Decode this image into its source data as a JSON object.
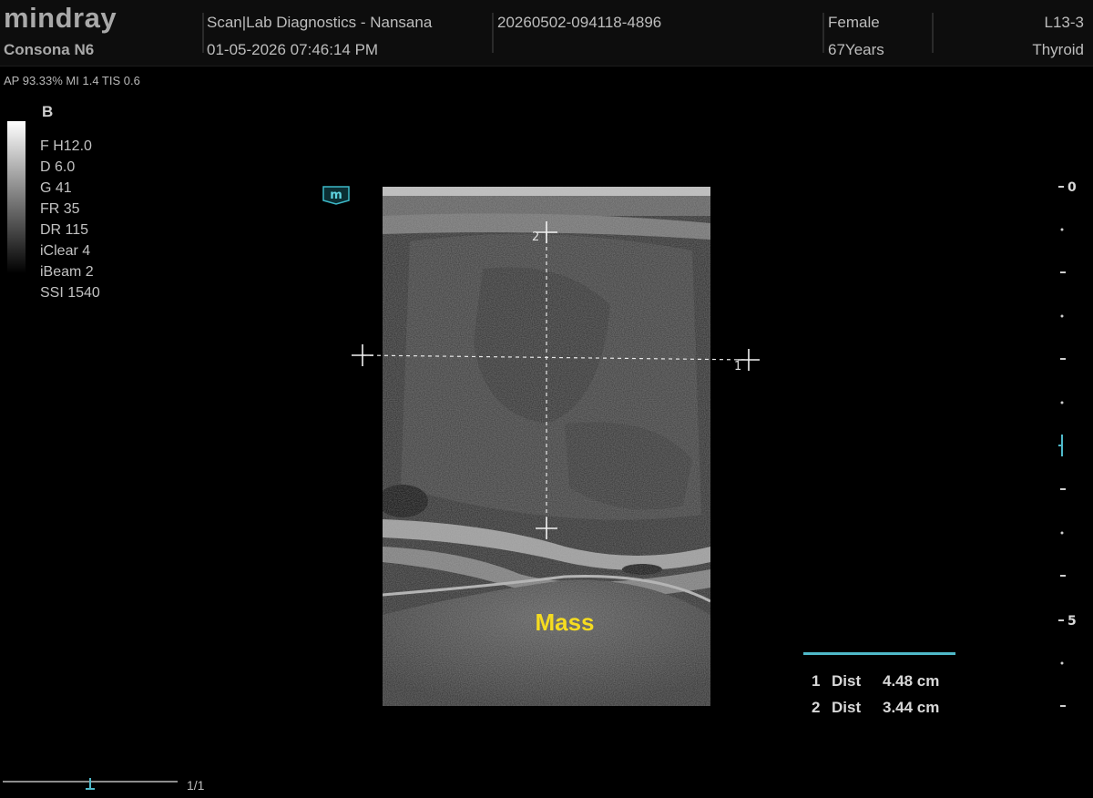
{
  "header": {
    "brand": "mindray",
    "model": "Consona N6",
    "institution": "Scan|Lab Diagnostics - Nansana",
    "datetime": "01-05-2026  07:46:14 PM",
    "exam_id": "20260502-094118-4896",
    "gender": "Female",
    "age": "67Years",
    "probe": "L13-3",
    "preset": "Thyroid"
  },
  "power_line": "AP 93.33%  MI 1.4 TIS 0.6",
  "mode": "B",
  "params": [
    "F H12.0",
    "D 6.0",
    "G 41",
    "FR 35",
    "DR 115",
    "iClear 4",
    "iBeam 2",
    "SSI 1540"
  ],
  "image": {
    "annotation": "Mass",
    "caliper_labels": [
      "1",
      "2"
    ],
    "probe_badge": "m"
  },
  "depth_scale": {
    "labels": [
      "0",
      "5"
    ]
  },
  "measurements": [
    {
      "index": "1",
      "type": "Dist",
      "value": "4.48 cm"
    },
    {
      "index": "2",
      "type": "Dist",
      "value": "3.44 cm"
    }
  ],
  "cine": {
    "frame": "1/1"
  },
  "colors": {
    "accent": "#4fb9c9",
    "annotation": "#f5dc20"
  }
}
